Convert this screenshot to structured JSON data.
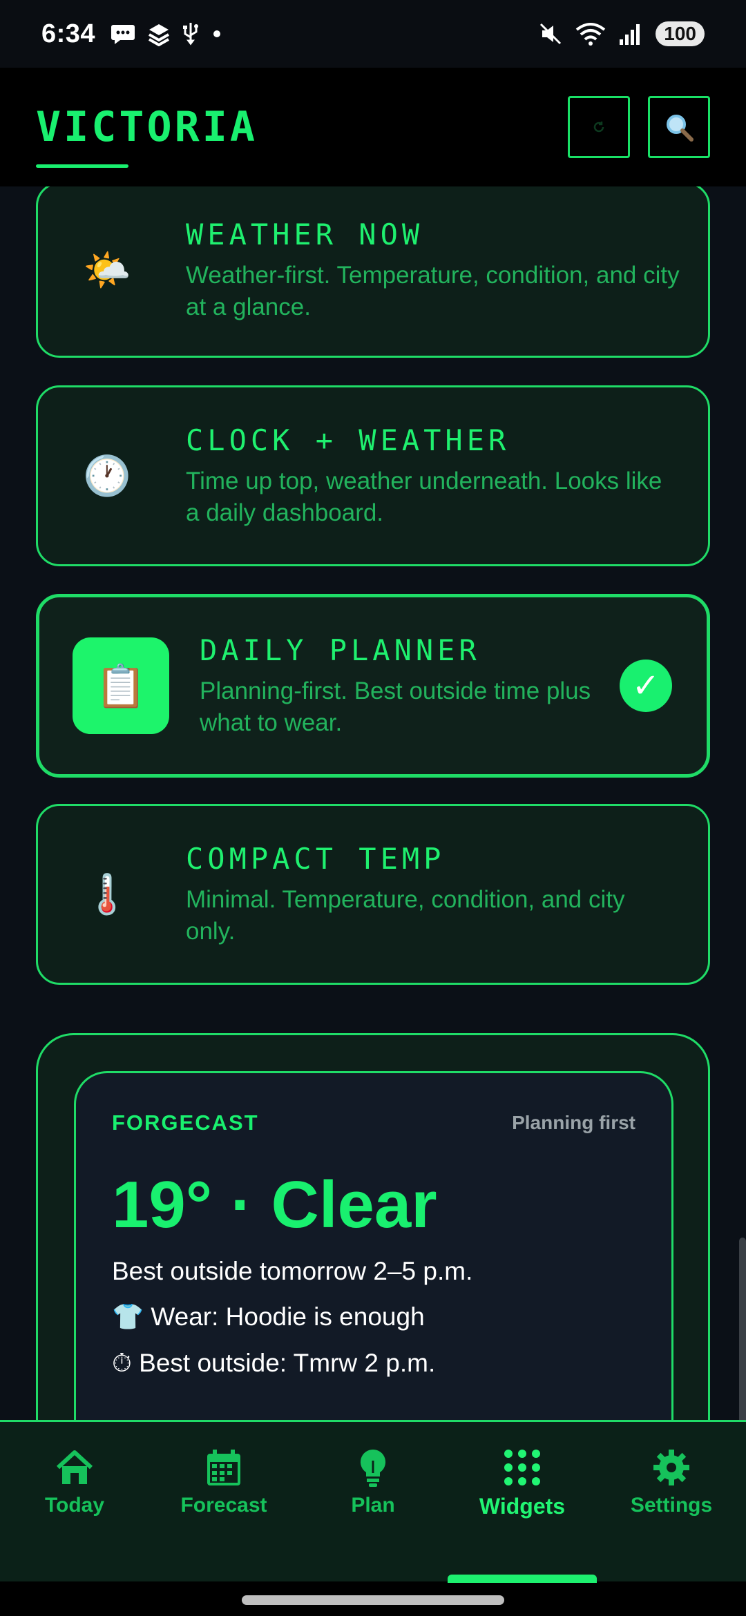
{
  "status_bar": {
    "time": "6:34",
    "battery": "100",
    "left_icons": [
      "chat-bubble-icon",
      "stack-icon",
      "usb-icon",
      "dot-icon"
    ],
    "right_icons": [
      "mute-icon",
      "wifi-icon",
      "signal-icon",
      "battery-icon"
    ]
  },
  "app_bar": {
    "title": "VICTORIA",
    "actions": [
      "refresh-icon",
      "search-icon"
    ]
  },
  "widget_options": [
    {
      "icon": "🌤️",
      "icon_name": "sun-behind-cloud-icon",
      "title": "WEATHER NOW",
      "desc": "Weather-first. Temperature, condition, and city at a glance.",
      "selected": false
    },
    {
      "icon": "🕐",
      "icon_name": "clock-icon",
      "title": "CLOCK + WEATHER",
      "desc": "Time up top, weather underneath. Looks like a daily dashboard.",
      "selected": false
    },
    {
      "icon": "📋",
      "icon_name": "clipboard-icon",
      "title": "DAILY PLANNER",
      "desc": "Planning-first. Best outside time plus what to wear.",
      "selected": true,
      "check": "✓"
    },
    {
      "icon": "🌡️",
      "icon_name": "thermometer-icon",
      "title": "COMPACT TEMP",
      "desc": "Minimal. Temperature, condition, and city only.",
      "selected": false
    }
  ],
  "preview": {
    "brand": "FORGECAST",
    "mode": "Planning first",
    "temp_line": "19° · Clear",
    "best_line": "Best outside tomorrow 2–5 p.m.",
    "wear_icon": "👕",
    "wear_line": "Wear: Hoodie is enough",
    "timer_icon": "⏱",
    "outside_line": "Best outside: Tmrw 2 p.m."
  },
  "bottom_nav": [
    {
      "label": "Today",
      "icon": "home-icon",
      "active": false
    },
    {
      "label": "Forecast",
      "icon": "calendar-icon",
      "active": false
    },
    {
      "label": "Plan",
      "icon": "lightbulb-icon",
      "active": false
    },
    {
      "label": "Widgets",
      "icon": "grid-icon",
      "active": true
    },
    {
      "label": "Settings",
      "icon": "gear-icon",
      "active": false
    }
  ],
  "colors": {
    "accent": "#19f06f",
    "background": "#0b1017",
    "card": "#0d1f19"
  }
}
